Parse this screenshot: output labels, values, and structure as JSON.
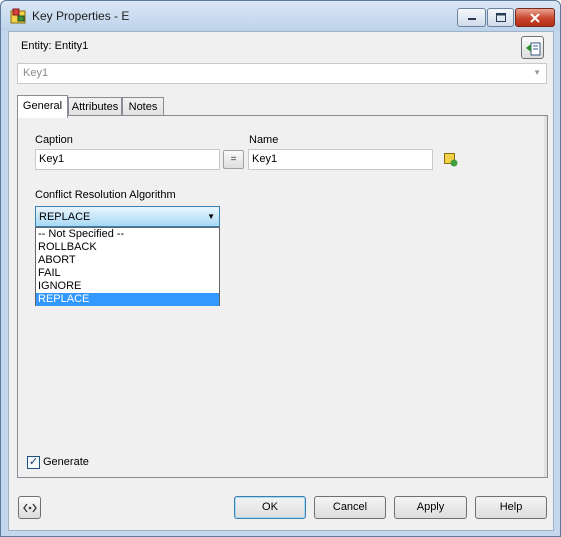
{
  "window": {
    "title": "Key Properties - E"
  },
  "header": {
    "entity_label": "Entity: Entity1",
    "key_combo_value": "Key1"
  },
  "tabs": [
    {
      "label": "General",
      "active": true
    },
    {
      "label": "Attributes",
      "active": false
    },
    {
      "label": "Notes",
      "active": false
    }
  ],
  "general": {
    "caption_label": "Caption",
    "caption_value": "Key1",
    "equals_label": "=",
    "name_label": "Name",
    "name_value": "Key1",
    "algorithm_label": "Conflict Resolution Algorithm",
    "algorithm_selected": "REPLACE",
    "algorithm_options": [
      "-- Not Specified --",
      "ROLLBACK",
      "ABORT",
      "FAIL",
      "IGNORE",
      "REPLACE"
    ],
    "generate_label": "Generate",
    "generate_checked": true
  },
  "buttons": {
    "ok": "OK",
    "cancel": "Cancel",
    "apply": "Apply",
    "help": "Help"
  },
  "icons": {
    "app": "key-properties-icon",
    "entity": "entity-navigate-icon",
    "name_action": "name-action-icon",
    "script_button": "script-icon"
  },
  "colors": {
    "selection": "#3399ff",
    "dropdown_highlight": "#a7d9f5"
  }
}
